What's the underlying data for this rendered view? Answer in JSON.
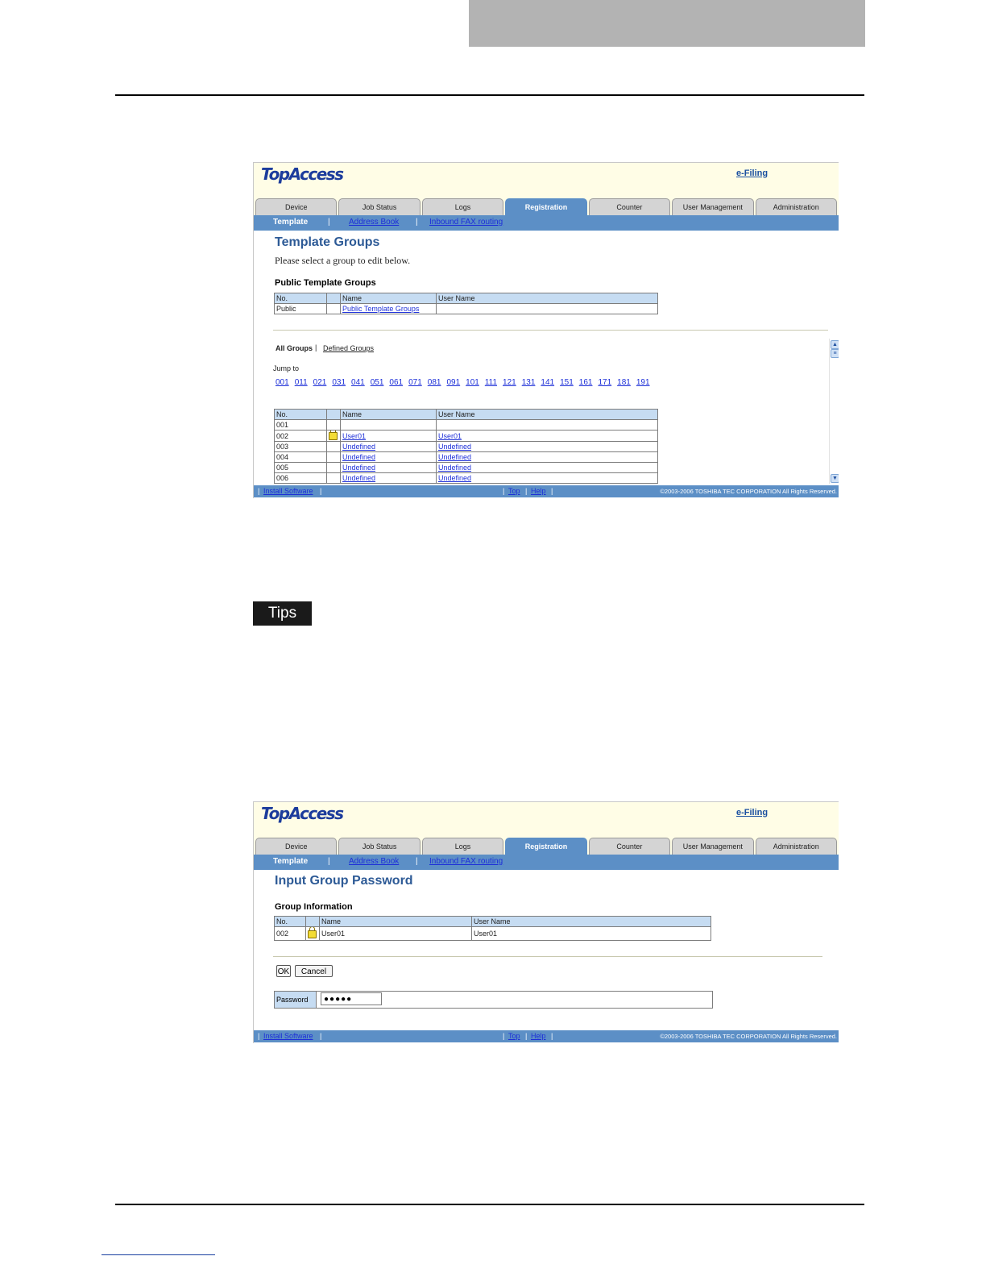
{
  "screen1": {
    "logo": "TopAccess",
    "efiling": "e-Filing",
    "tabs": [
      "Device",
      "Job Status",
      "Logs",
      "Registration",
      "Counter",
      "User Management",
      "Administration"
    ],
    "subnav": {
      "template": "Template",
      "sep": "|",
      "address_book": "Address Book",
      "inbound_fax": "Inbound FAX routing"
    },
    "title": "Template Groups",
    "instruction": "Please select a group to edit below.",
    "public_section": "Public Template Groups",
    "headers": {
      "no": "No.",
      "name": "Name",
      "user": "User Name"
    },
    "public_row": {
      "no": "Public",
      "name": "Public Template Groups",
      "user": ""
    },
    "filter": {
      "all": "All Groups",
      "sep": "|",
      "defined": "Defined Groups"
    },
    "jump_label": "Jump to",
    "jumps": [
      "001",
      "011",
      "021",
      "031",
      "041",
      "051",
      "061",
      "071",
      "081",
      "091",
      "101",
      "111",
      "121",
      "131",
      "141",
      "151",
      "161",
      "171",
      "181",
      "191"
    ],
    "rows": [
      {
        "no": "001",
        "name": "",
        "user": ""
      },
      {
        "no": "002",
        "name": "User01",
        "user": "User01"
      },
      {
        "no": "003",
        "name": "Undefined",
        "user": "Undefined"
      },
      {
        "no": "004",
        "name": "Undefined",
        "user": "Undefined"
      },
      {
        "no": "005",
        "name": "Undefined",
        "user": "Undefined"
      },
      {
        "no": "006",
        "name": "Undefined",
        "user": "Undefined"
      }
    ],
    "footer": {
      "install": "Install Software",
      "top": "Top",
      "help": "Help",
      "copyright": "©2003-2006 TOSHIBA TEC CORPORATION All Rights Reserved."
    }
  },
  "tips_label": "Tips",
  "screen2": {
    "logo": "TopAccess",
    "efiling": "e-Filing",
    "tabs": [
      "Device",
      "Job Status",
      "Logs",
      "Registration",
      "Counter",
      "User Management",
      "Administration"
    ],
    "subnav": {
      "template": "Template",
      "sep": "|",
      "address_book": "Address Book",
      "inbound_fax": "Inbound FAX routing"
    },
    "title": "Input Group Password",
    "section": "Group Information",
    "headers": {
      "no": "No.",
      "name": "Name",
      "user": "User Name"
    },
    "row": {
      "no": "002",
      "name": "User01",
      "user": "User01"
    },
    "ok": "OK",
    "cancel": "Cancel",
    "password_label": "Password",
    "password_value": "●●●●●",
    "footer": {
      "install": "Install Software",
      "top": "Top",
      "help": "Help",
      "copyright": "©2003-2006 TOSHIBA TEC CORPORATION All Rights Reserved."
    }
  },
  "colors": {
    "accent": "#5c8fc6",
    "banner": "#fffde6",
    "header_cell": "#c6dcf2",
    "link": "#1d2fd8"
  }
}
